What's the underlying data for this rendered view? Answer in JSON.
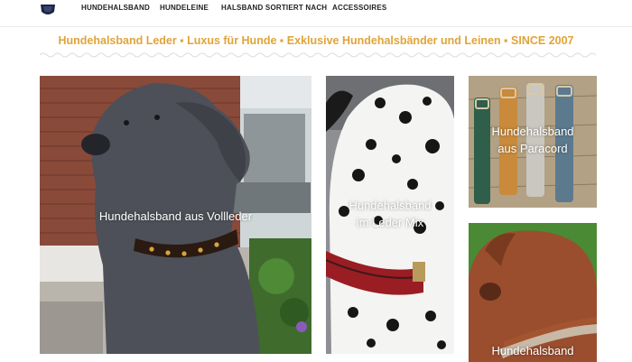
{
  "nav": {
    "items": [
      {
        "label": "HUNDEHALSBAND"
      },
      {
        "label": "HUNDELEINE"
      },
      {
        "label": "HALSBAND SORTIERT NACH"
      },
      {
        "label": "ACCESSOIRES"
      }
    ]
  },
  "header": {
    "tagline": "Hundehalsband Leder ▪ Luxus für Hunde ▪ Exklusive Hundehalsbänder und Leinen ▪ SINCE 2007"
  },
  "tiles": [
    {
      "label": "Hundehalsband aus Vollleder"
    },
    {
      "line1": "Hundehalsband",
      "line2": "im Leder Mix"
    },
    {
      "line1": "Hundehalsband",
      "line2": "aus Paracord"
    },
    {
      "label": "Hundehalsband"
    }
  ],
  "colors": {
    "accent": "#e0a33a",
    "nav_text": "#222222",
    "topbar": "#1a1a1a"
  },
  "icons": [
    "logo-icon",
    "wave-divider"
  ]
}
